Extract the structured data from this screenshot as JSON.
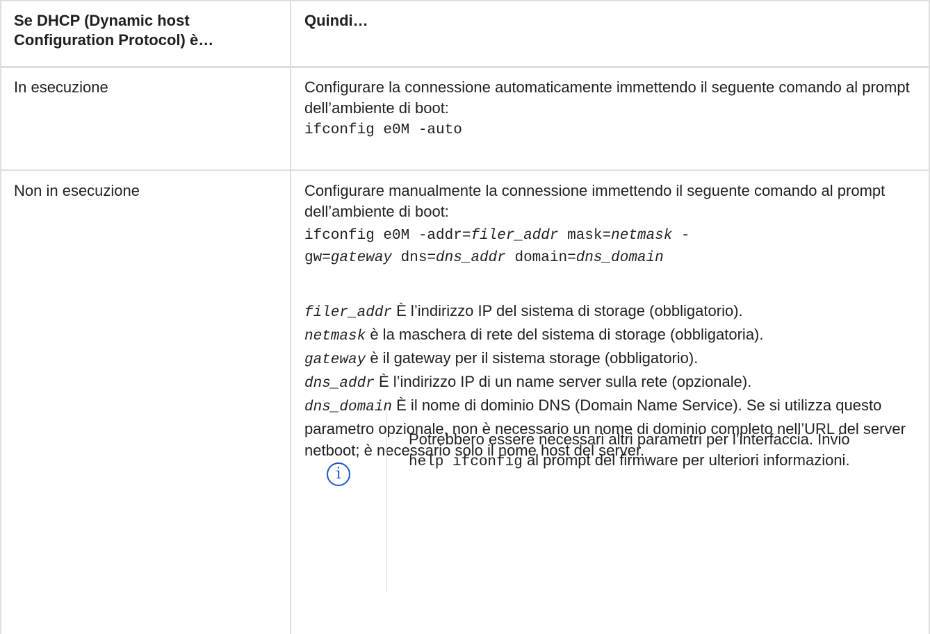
{
  "table": {
    "headers": {
      "col1": "Se DHCP (Dynamic host Configuration Protocol) è…",
      "col2": "Quindi…"
    },
    "rows": [
      {
        "condition": "In esecuzione",
        "text": "Configurare la connessione automaticamente immettendo il seguente comando al prompt dell’ambiente di boot:",
        "command": "ifconfig e0M -auto"
      },
      {
        "condition": "Non in esecuzione",
        "text": "Configurare manualmente la connessione immettendo il seguente comando al prompt dell’ambiente di boot:",
        "command": {
          "p1": "ifconfig e0M -addr=",
          "v1": "filer_addr",
          "p2": " mask=",
          "v2": "netmask",
          "p3": " -",
          "p4": "gw=",
          "v3": "gateway",
          "p5": " dns=",
          "v4": "dns_addr",
          "p6": " domain=",
          "v5": "dns_domain"
        },
        "params": [
          {
            "name": "filer_addr",
            "desc": " È l’indirizzo IP del sistema di storage (obbligatorio)."
          },
          {
            "name": "netmask",
            "desc": " è la maschera di rete del sistema di storage (obbligatoria)."
          },
          {
            "name": "gateway",
            "desc": " è il gateway per il sistema storage (obbligatorio)."
          },
          {
            "name": "dns_addr",
            "desc": " È l’indirizzo IP di un name server sulla rete (opzionale)."
          },
          {
            "name": "dns_domain",
            "desc": " È il nome di dominio DNS (Domain Name Service). Se si utilizza questo parametro opzionale, non è necessario un nome di dominio completo nell’URL del server netboot; è necessario solo il nome host del server."
          }
        ],
        "tip": {
          "icon": "info-icon",
          "before": "Potrebbero essere necessari altri parametri per l’interfaccia. Invio ",
          "code": "help ifconfig",
          "after": " al prompt del firmware per ulteriori informazioni."
        }
      }
    ]
  }
}
